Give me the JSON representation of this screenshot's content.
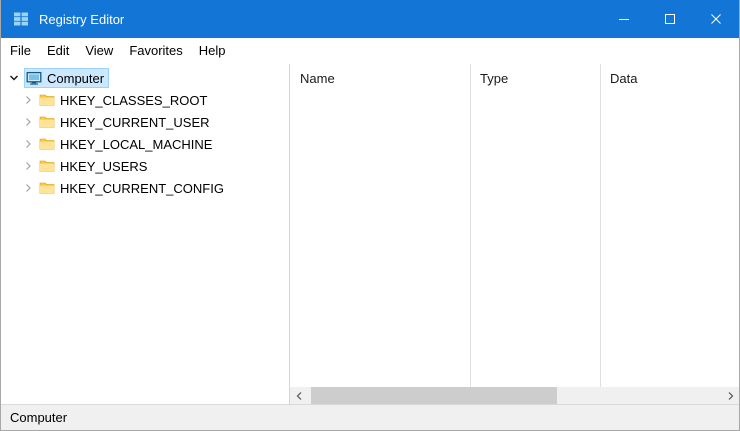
{
  "window": {
    "title": "Registry Editor",
    "controls": {
      "minimize": "minimize",
      "maximize": "maximize",
      "close": "close"
    }
  },
  "menu": {
    "items": [
      "File",
      "Edit",
      "View",
      "Favorites",
      "Help"
    ]
  },
  "tree": {
    "root": {
      "label": "Computer",
      "expanded": true,
      "selected": true,
      "icon": "computer-icon"
    },
    "children": [
      {
        "label": "HKEY_CLASSES_ROOT",
        "icon": "folder-icon",
        "expanded": false
      },
      {
        "label": "HKEY_CURRENT_USER",
        "icon": "folder-icon",
        "expanded": false
      },
      {
        "label": "HKEY_LOCAL_MACHINE",
        "icon": "folder-icon",
        "expanded": false
      },
      {
        "label": "HKEY_USERS",
        "icon": "folder-icon",
        "expanded": false
      },
      {
        "label": "HKEY_CURRENT_CONFIG",
        "icon": "folder-icon",
        "expanded": false
      }
    ]
  },
  "list": {
    "columns": [
      "Name",
      "Type",
      "Data"
    ],
    "rows": []
  },
  "statusbar": {
    "text": "Computer"
  },
  "icons": {
    "titlebar": "registry-editor-icon",
    "expanded_twisty": "chevron-down-icon",
    "collapsed_twisty": "chevron-right-icon"
  },
  "colors": {
    "titlebar_bg": "#1376d6",
    "titlebar_fg": "#ffffff",
    "selection_bg": "#cce8ff",
    "selection_border": "#99d1ff",
    "folder": "#ffc93c",
    "scrollbar_track": "#f0f0f0",
    "scrollbar_thumb": "#cdcdcd",
    "statusbar_bg": "#f0f0f0"
  }
}
